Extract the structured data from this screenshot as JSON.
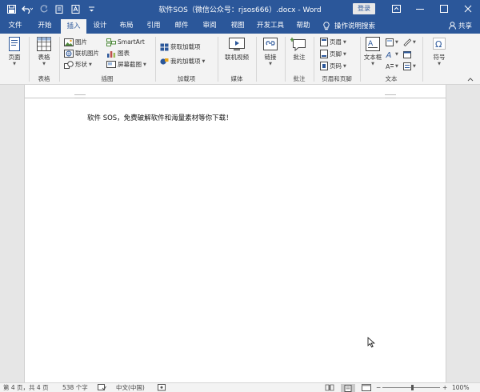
{
  "window": {
    "title": "软件SOS（微信公众号：rjsos666）.docx - Word",
    "login_label": "登录"
  },
  "tabs": [
    {
      "label": "文件"
    },
    {
      "label": "开始"
    },
    {
      "label": "插入"
    },
    {
      "label": "设计"
    },
    {
      "label": "布局"
    },
    {
      "label": "引用"
    },
    {
      "label": "邮件"
    },
    {
      "label": "审阅"
    },
    {
      "label": "视图"
    },
    {
      "label": "开发工具"
    },
    {
      "label": "帮助"
    }
  ],
  "active_tab": "插入",
  "tell_me": "操作说明搜索",
  "share": "共享",
  "ribbon": {
    "pages": {
      "label": "页面"
    },
    "tables": {
      "button": "表格",
      "group": "表格"
    },
    "illustrations": {
      "group": "插图",
      "pictures": "图片",
      "online_pictures": "联机图片",
      "shapes": "形状",
      "smartart": "SmartArt",
      "chart": "图表",
      "screenshot": "屏幕截图"
    },
    "addins": {
      "group": "加载项",
      "get_addins": "获取加载项",
      "my_addins": "我的加载项"
    },
    "media": {
      "group": "媒体",
      "online_video": "联机视频"
    },
    "links": {
      "label": "链接"
    },
    "comments": {
      "group": "批注",
      "comment": "批注"
    },
    "header_footer": {
      "group": "页眉和页脚",
      "header": "页眉",
      "footer": "页脚",
      "page_number": "页码"
    },
    "text": {
      "group": "文本",
      "textbox": "文本框"
    },
    "symbols": {
      "label": "符号"
    }
  },
  "document": {
    "text": "软件 SOS，免费破解软件和海量素材等你下载！"
  },
  "status": {
    "page": "第 4 页，共 4 页",
    "words": "538 个字",
    "language": "中文(中国)",
    "zoom": "100%"
  },
  "colors": {
    "accent": "#2b579a",
    "ribbon_bg": "#f3f3f3",
    "doc_bg": "#e6e6e6"
  }
}
